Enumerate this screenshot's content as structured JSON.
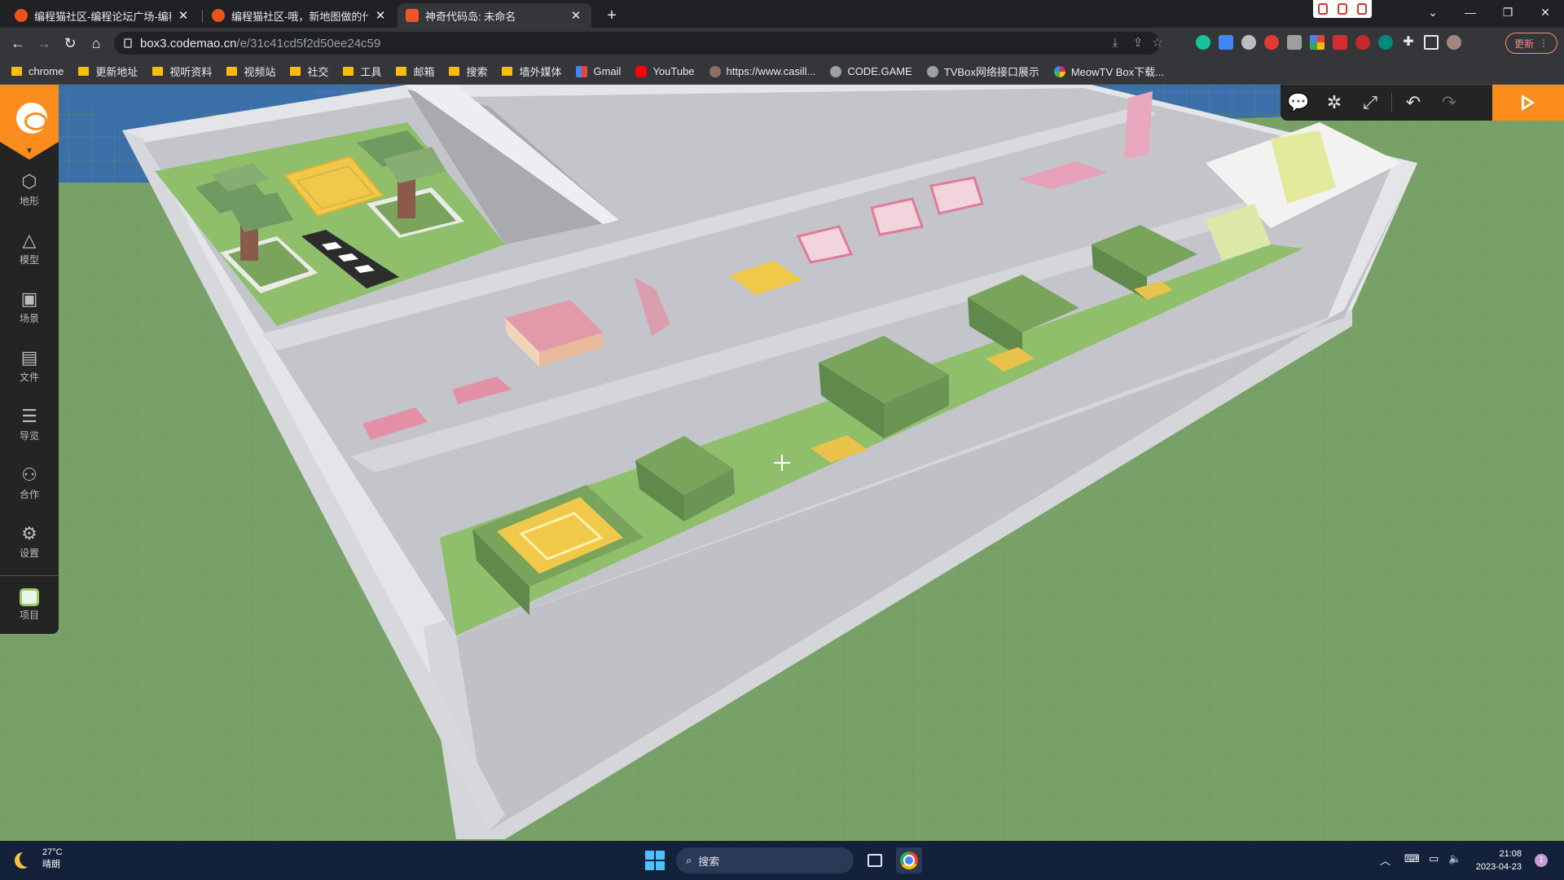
{
  "browser": {
    "tabs": [
      {
        "title": "编程猫社区-编程论坛广场-编程猫",
        "active": false
      },
      {
        "title": "编程猫社区-哦，新地图做的什么",
        "active": false
      },
      {
        "title": "神奇代码岛: 未命名",
        "active": true
      }
    ],
    "new_tab": "+",
    "address": {
      "host": "box3.codemao.cn",
      "path": "/e/31c41cd5f2d50ee24c59"
    },
    "update_label": "更新",
    "bookmarks": [
      {
        "label": "chrome",
        "icon": "folder-icon"
      },
      {
        "label": "更新地址",
        "icon": "folder-icon"
      },
      {
        "label": "视听资料",
        "icon": "folder-icon"
      },
      {
        "label": "视频站",
        "icon": "folder-icon"
      },
      {
        "label": "社交",
        "icon": "folder-icon"
      },
      {
        "label": "工具",
        "icon": "folder-icon"
      },
      {
        "label": "邮箱",
        "icon": "folder-icon"
      },
      {
        "label": "搜索",
        "icon": "folder-icon"
      },
      {
        "label": "墙外媒体",
        "icon": "folder-icon"
      },
      {
        "label": "Gmail",
        "icon": "gmail-icon"
      },
      {
        "label": "YouTube",
        "icon": "youtube-icon"
      },
      {
        "label": "https://www.casill...",
        "icon": "site-icon"
      },
      {
        "label": "CODE.GAME",
        "icon": "globe-icon"
      },
      {
        "label": "TVBox网络接口展示",
        "icon": "globe-icon"
      },
      {
        "label": "MeowTV Box下载...",
        "icon": "pinwheel-icon"
      }
    ]
  },
  "editor": {
    "sidebar": [
      {
        "label": "地形",
        "icon": "cube-icon"
      },
      {
        "label": "模型",
        "icon": "bell-icon"
      },
      {
        "label": "场景",
        "icon": "image-icon"
      },
      {
        "label": "文件",
        "icon": "file-icon"
      },
      {
        "label": "导览",
        "icon": "list-icon"
      },
      {
        "label": "合作",
        "icon": "users-icon"
      },
      {
        "label": "设置",
        "icon": "gear-icon"
      },
      {
        "label": "项目",
        "icon": "project-icon"
      }
    ],
    "tools": [
      "comment-icon",
      "bug-icon",
      "resize-icon",
      "undo-icon",
      "redo-icon"
    ],
    "run": "play-icon"
  },
  "taskbar": {
    "temperature": "27°C",
    "weather": "晴朗",
    "search_placeholder": "搜索",
    "time": "21:08",
    "date": "2023-04-23",
    "notifications": "1"
  },
  "colors": {
    "accent": "#fb8c1e",
    "grass": "#78a168",
    "wall": "#c7c9cf",
    "water": "#3b6fa8"
  }
}
